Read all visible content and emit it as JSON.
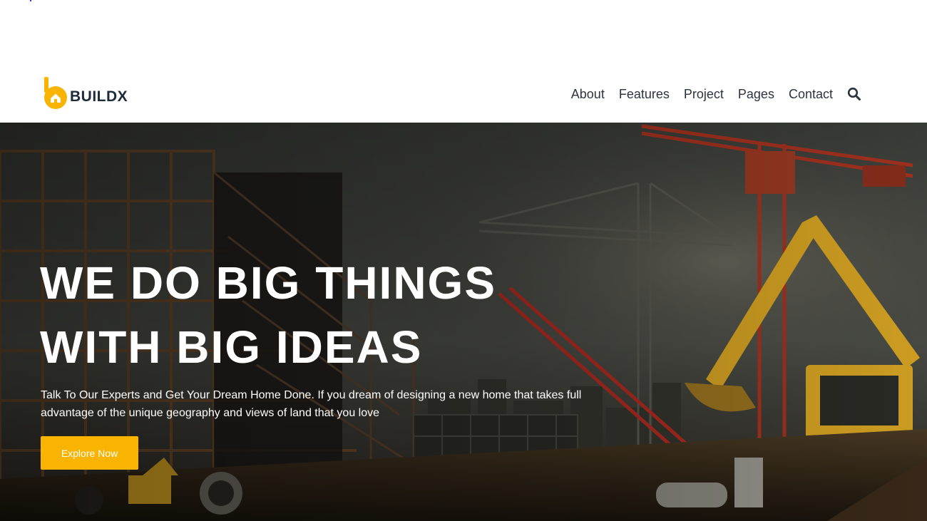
{
  "brand": {
    "name": "BUILDX",
    "accent": "#f8b400",
    "text_color": "#1d2b3a"
  },
  "nav": {
    "items": [
      {
        "label": "About"
      },
      {
        "label": "Features"
      },
      {
        "label": "Project"
      },
      {
        "label": "Pages"
      },
      {
        "label": "Contact"
      }
    ],
    "search_icon": "search-icon"
  },
  "hero": {
    "title_lines": [
      "WE DO BIG THINGS",
      "WITH BIG IDEAS"
    ],
    "text": "Talk To Our Experts and Get Your Dream Home Done. If you dream of designing a new home that takes full advantage of the unique geography and views of land that you love",
    "cta_label": "Explore Now",
    "background": "construction-site-illustration"
  }
}
